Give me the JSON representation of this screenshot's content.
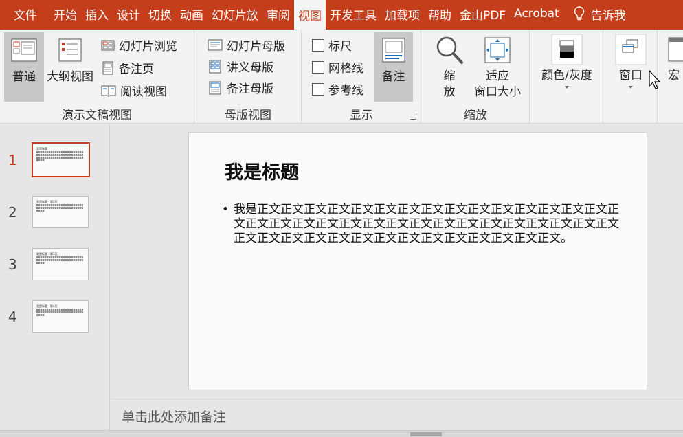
{
  "ribbon_tabs": [
    "文件",
    "开始",
    "插入",
    "设计",
    "切换",
    "动画",
    "幻灯片放",
    "审阅",
    "视图",
    "开发工具",
    "加载项",
    "帮助",
    "金山PDF",
    "Acrobat",
    "告诉我"
  ],
  "active_tab": "视图",
  "groups": {
    "presentation_views": {
      "label": "演示文稿视图",
      "normal": "普通",
      "outline": "大纲视图",
      "slide_sorter": "幻灯片浏览",
      "notes_page": "备注页",
      "reading_view": "阅读视图"
    },
    "master_views": {
      "label": "母版视图",
      "slide_master": "幻灯片母版",
      "handout_master": "讲义母版",
      "notes_master": "备注母版"
    },
    "show": {
      "label": "显示",
      "ruler": "标尺",
      "gridlines": "网格线",
      "guides": "参考线",
      "notes": "备注"
    },
    "zoom": {
      "label": "缩放",
      "zoom_line1": "缩",
      "zoom_line2": "放",
      "fit_line1": "适应",
      "fit_line2": "窗口大小"
    },
    "color": {
      "label": "颜色/灰度"
    },
    "window": {
      "label": "窗口"
    },
    "macros": {
      "label_partial": "宏"
    }
  },
  "thumbnails": [
    {
      "number": "1",
      "title": "我是标题",
      "active": true
    },
    {
      "number": "2",
      "title": "我是标题 - 第2页",
      "active": false
    },
    {
      "number": "3",
      "title": "我是标题 - 第3页",
      "active": false
    },
    {
      "number": "4",
      "title": "我是标题 - 第4页",
      "active": false
    }
  ],
  "slide": {
    "title": "我是标题",
    "bullet": "•",
    "body": "我是正文正文正文正文正文正文正文正文正文正文正文正文正文正文正文正文正文正文正文正文正文正文正文正文正文正文正文正文正文正文正文正文正文正文正文正文正文正文正文正文正文正文正文正文正文正文。"
  },
  "notes_placeholder": "单击此处添加备注",
  "colors": {
    "accent": "#c43e1c",
    "ribbon_bg": "#f3f3f3",
    "workspace_bg": "#e6e6e6"
  }
}
